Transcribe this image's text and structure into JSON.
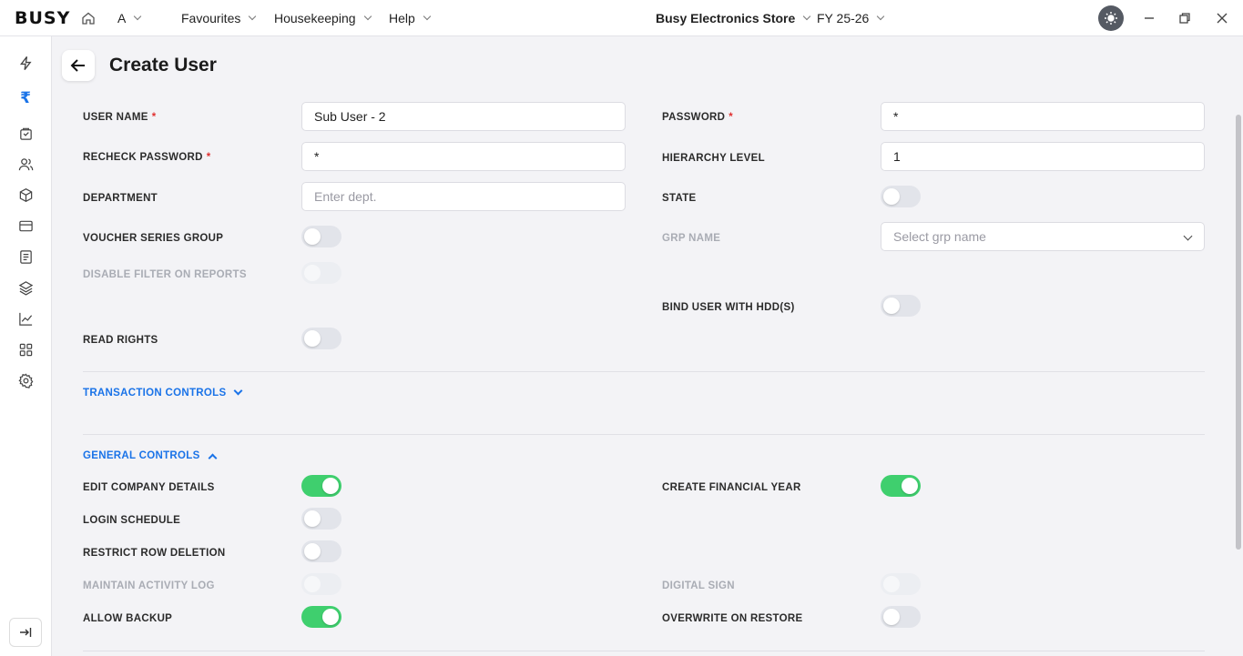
{
  "topbar": {
    "logo": "BUSY",
    "user_initial": "A",
    "menus": [
      "Favourites",
      "Housekeeping",
      "Help"
    ],
    "company": "Busy Electronics Store",
    "fiscal_year": "FY 25-26"
  },
  "page": {
    "title": "Create User"
  },
  "form": {
    "user_name": {
      "label": "USER NAME",
      "value": "Sub User - 2"
    },
    "password": {
      "label": "PASSWORD",
      "value": "*"
    },
    "recheck_password": {
      "label": "RECHECK PASSWORD",
      "value": "*"
    },
    "hierarchy_level": {
      "label": "HIERARCHY LEVEL",
      "value": "1"
    },
    "department": {
      "label": "DEPARTMENT",
      "placeholder": "Enter dept."
    },
    "state": {
      "label": "STATE",
      "on": false
    },
    "voucher_series_group": {
      "label": "VOUCHER SERIES GROUP",
      "on": false
    },
    "grp_name": {
      "label": "GRP NAME",
      "placeholder": "Select grp name"
    },
    "disable_filter": {
      "label": "DISABLE FILTER ON REPORTS",
      "on": false,
      "disabled": true
    },
    "bind_user_hdd": {
      "label": "BIND USER WITH HDD(S)",
      "on": false
    },
    "read_rights": {
      "label": "READ RIGHTS",
      "on": false
    }
  },
  "sections": {
    "transaction_controls": "TRANSACTION CONTROLS",
    "general_controls": "GENERAL CONTROLS"
  },
  "general_controls": {
    "edit_company_details": {
      "label": "EDIT COMPANY DETAILS",
      "on": true
    },
    "create_financial_year": {
      "label": "CREATE FINANCIAL YEAR",
      "on": true
    },
    "login_schedule": {
      "label": "LOGIN SCHEDULE",
      "on": false
    },
    "restrict_row_deletion": {
      "label": "RESTRICT ROW DELETION",
      "on": false
    },
    "maintain_activity_log": {
      "label": "MAINTAIN ACTIVITY LOG",
      "on": false,
      "disabled": true
    },
    "digital_sign": {
      "label": "DIGITAL SIGN",
      "on": false,
      "disabled": true
    },
    "allow_backup": {
      "label": "ALLOW BACKUP",
      "on": true
    },
    "overwrite_on_restore": {
      "label": "OVERWRITE ON RESTORE",
      "on": false
    }
  },
  "colors": {
    "accent": "#1a73e8",
    "toggle_on": "#3fcf6e",
    "required": "#e03131"
  },
  "sidebar_icons": [
    "lightning-icon",
    "rupee-icon",
    "bag-icon",
    "users-icon",
    "box-icon",
    "card-icon",
    "document-icon",
    "layers-icon",
    "chart-icon",
    "grid-icon",
    "gear-icon"
  ]
}
